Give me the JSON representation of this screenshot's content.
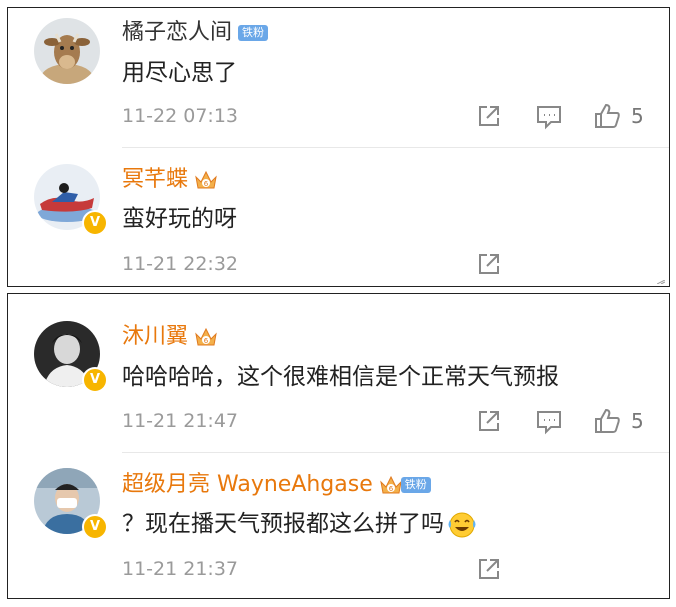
{
  "panels": [
    {
      "comments": [
        {
          "username": "橘子恋人间",
          "badge": "铁粉",
          "text": "用尽心思了",
          "time": "11-22 07:13",
          "like_count": "5",
          "avatar_icon": "cow-avatar"
        },
        {
          "username": "冥芊蝶",
          "crown_level": "6",
          "text": "蛮好玩的呀",
          "time": "11-21 22:32",
          "avatar_icon": "superhero-avatar",
          "verified_mark": "V"
        }
      ]
    },
    {
      "comments": [
        {
          "username": "沐川翼",
          "crown_level": "6",
          "text": "哈哈哈哈，这个很难相信是个正常天气预报",
          "time": "11-21 21:47",
          "like_count": "5",
          "avatar_icon": "bw-portrait-avatar",
          "verified_mark": "V"
        },
        {
          "username": "超级月亮 WayneAhgase",
          "crown_level": "6",
          "badge": "铁粉",
          "text": "？现在播天气预报都这么拼了吗",
          "emoji": "laughing-crying-emoji",
          "time": "11-21 21:37",
          "avatar_icon": "masked-person-avatar",
          "verified_mark": "V"
        }
      ]
    }
  ],
  "colors": {
    "vip_name": "#e8780c",
    "plain_name": "#333333",
    "badge_bg": "#6aa7e8",
    "verified": "#f7b500",
    "meta": "#9a9a9a"
  }
}
